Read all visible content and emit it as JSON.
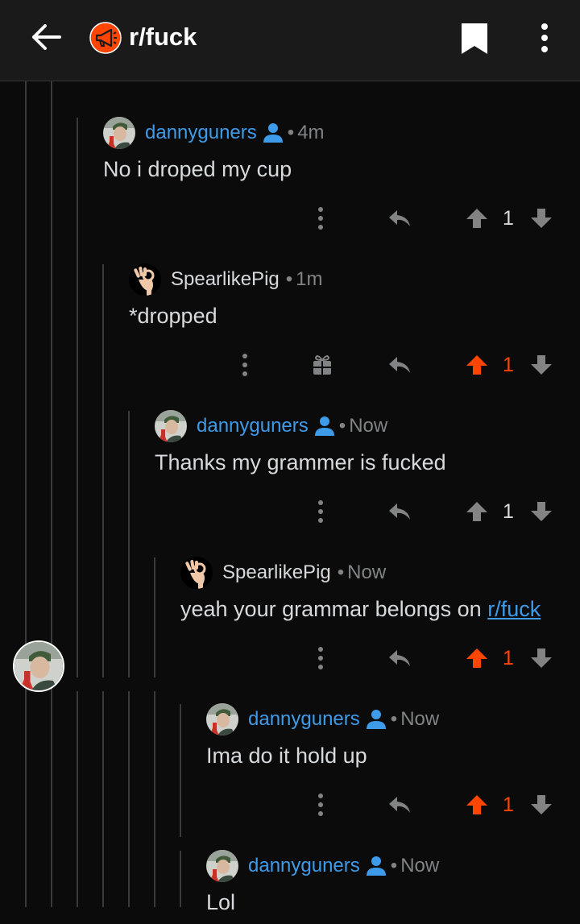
{
  "header": {
    "subreddit": "r/fuck",
    "icons": {
      "back": "arrow-left-icon",
      "subreddit": "megaphone-icon",
      "save": "bookmark-icon",
      "more": "more-vertical-icon"
    },
    "colors": {
      "accent": "#ff4500",
      "link": "#3d9be9",
      "background": "#0b0b0b"
    }
  },
  "comments": [
    {
      "author": "dannyguners",
      "op": true,
      "time": "4m",
      "body": "No i droped my cup",
      "votes": "1",
      "upvoted": false
    },
    {
      "author": "SpearlikePig",
      "op": false,
      "time": "1m",
      "body": "*dropped",
      "votes": "1",
      "upvoted": true,
      "gift": true
    },
    {
      "author": "dannyguners",
      "op": true,
      "time": "Now",
      "body": "Thanks my grammer is fucked",
      "votes": "1",
      "upvoted": false
    },
    {
      "author": "SpearlikePig",
      "op": false,
      "time": "Now",
      "body_prefix": "yeah your grammar belongs on ",
      "body_link": "r/fuck",
      "votes": "1",
      "upvoted": true
    },
    {
      "author": "dannyguners",
      "op": true,
      "time": "Now",
      "body": "Ima do it hold up",
      "votes": "1",
      "upvoted": true
    },
    {
      "author": "dannyguners",
      "op": true,
      "time": "Now",
      "body": "Lol"
    }
  ]
}
